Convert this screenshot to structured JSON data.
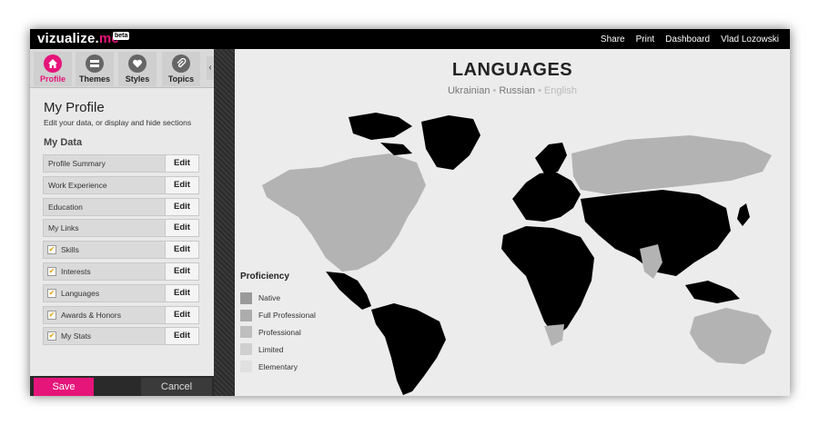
{
  "app": {
    "logo_main": "vizualize.",
    "logo_accent": "me",
    "badge": "beta"
  },
  "topnav": [
    "Share",
    "Print",
    "Dashboard",
    "Vlad Lozowski"
  ],
  "tabs": [
    {
      "label": "Profile",
      "icon": "home-icon"
    },
    {
      "label": "Themes",
      "icon": "themes-icon"
    },
    {
      "label": "Styles",
      "icon": "heart-icon"
    },
    {
      "label": "Topics",
      "icon": "paperclip-icon"
    }
  ],
  "sidebar": {
    "title": "My Profile",
    "subtitle": "Edit your data, or display and hide sections",
    "section": "My Data",
    "edit_label": "Edit",
    "items": [
      {
        "label": "Profile Summary",
        "checked": false
      },
      {
        "label": "Work Experience",
        "checked": false
      },
      {
        "label": "Education",
        "checked": false
      },
      {
        "label": "My Links",
        "checked": false
      },
      {
        "label": "Skills",
        "checked": true
      },
      {
        "label": "Interests",
        "checked": true
      },
      {
        "label": "Languages",
        "checked": true
      },
      {
        "label": "Awards & Honors",
        "checked": true
      },
      {
        "label": "My Stats",
        "checked": true
      }
    ],
    "save_label": "Save",
    "cancel_label": "Cancel"
  },
  "map": {
    "title": "LANGUAGES",
    "languages": [
      "Ukrainian",
      "Russian",
      "English"
    ],
    "legend_title": "Proficiency",
    "legend": [
      {
        "label": "Native",
        "color": "#9a9a9a"
      },
      {
        "label": "Full Professional",
        "color": "#acacac"
      },
      {
        "label": "Professional",
        "color": "#bebebe"
      },
      {
        "label": "Limited",
        "color": "#cfcfcf"
      },
      {
        "label": "Elementary",
        "color": "#e0e0e0"
      }
    ],
    "colors": {
      "highlight": "#000000",
      "land": "#b3b3b3"
    }
  },
  "colors": {
    "accent": "#e5157a",
    "topbar": "#000000"
  }
}
